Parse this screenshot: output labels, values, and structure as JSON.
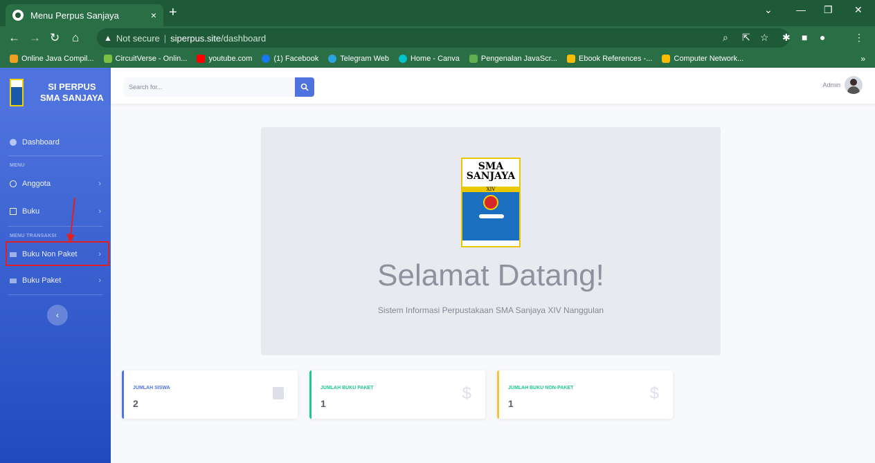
{
  "browser": {
    "tab_title": "Menu Perpus Sanjaya",
    "tab_close": "×",
    "new_tab": "+",
    "url_warning": "Not secure",
    "url_host": "siperpus.site",
    "url_path": "/dashboard",
    "bookmarks": [
      {
        "label": "Online Java Compil...",
        "color": "#f0a020"
      },
      {
        "label": "CircuitVerse - Onlin...",
        "color": "#7cc142"
      },
      {
        "label": "youtube.com",
        "color": "#ff0000"
      },
      {
        "label": "(1) Facebook",
        "color": "#1877f2"
      },
      {
        "label": "Telegram Web",
        "color": "#2aa3df"
      },
      {
        "label": "Home - Canva",
        "color": "#00c4cc"
      },
      {
        "label": "Pengenalan JavaScr...",
        "color": "#5fb04f"
      },
      {
        "label": "Ebook References -...",
        "color": "#fbbc04"
      },
      {
        "label": "Computer Network...",
        "color": "#fbbc04"
      }
    ],
    "bookmarks_more": "»"
  },
  "sidebar": {
    "brand_line1": "SI PERPUS",
    "brand_line2": "SMA SANJAYA",
    "dashboard": "Dashboard",
    "heading_menu": "MENU",
    "item_anggota": "Anggota",
    "item_buku": "Buku",
    "heading_transaksi": "MENU TRANSAKSI",
    "item_buku_non_paket": "Buku Non Paket",
    "item_buku_paket": "Buku Paket",
    "toggle": "‹"
  },
  "topbar": {
    "search_placeholder": "Search for...",
    "user_name": "Admin"
  },
  "main": {
    "crest_text_1": "SMA",
    "crest_text_2": "SANJAYA",
    "crest_text_3": "XIV",
    "welcome": "Selamat Datang!",
    "subtitle": "Sistem Informasi Perpustakaan SMA Sanjaya XIV Nanggulan"
  },
  "cards": [
    {
      "label": "JUMLAH SISWA",
      "value": "2",
      "color": "#4e73df"
    },
    {
      "label": "JUMLAH BUKU PAKET",
      "value": "1",
      "color": "#1cc88a"
    },
    {
      "label": "JUMLAH BUKU NON-PAKET",
      "value": "1",
      "color": "#f6c23e"
    }
  ],
  "colors": {
    "primary": "#4e73df",
    "success": "#1cc88a",
    "warning": "#f6c23e",
    "annotation": "#e02020"
  }
}
